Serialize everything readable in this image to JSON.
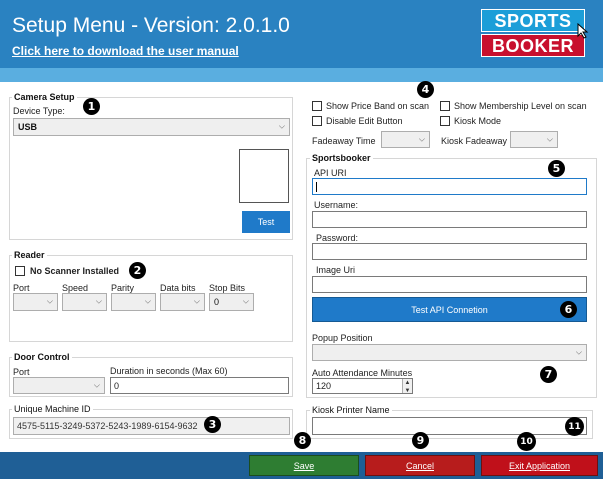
{
  "header": {
    "title": "Setup Menu - Version: 2.0.1.0",
    "manual_link": "Click here to download the user manual",
    "logo_top": "SPORTS",
    "logo_bottom": "BOOKER"
  },
  "camera": {
    "legend": "Camera Setup",
    "device_type_label": "Device Type:",
    "device_type_value": "USB",
    "test_button": "Test"
  },
  "reader": {
    "legend": "Reader",
    "no_scanner_label": "No Scanner Installed",
    "port_label": "Port",
    "speed_label": "Speed",
    "parity_label": "Parity",
    "data_bits_label": "Data bits",
    "stop_bits_label": "Stop Bits",
    "stop_bits_value": "0"
  },
  "door": {
    "legend": "Door Control",
    "port_label": "Port",
    "duration_label": "Duration in seconds (Max 60)",
    "duration_value": "0"
  },
  "machine": {
    "legend": "Unique Machine ID",
    "id_value": "4575-5115-3249-5372-5243-1989-6154-9632"
  },
  "options": {
    "show_price_band": "Show Price Band on scan",
    "show_membership": "Show Membership Level on scan",
    "disable_edit": "Disable Edit Button",
    "kiosk_mode": "Kiosk Mode",
    "fadeaway_time_label": "Fadeaway Time",
    "kiosk_fadeaway_label": "Kiosk Fadeaway"
  },
  "sportsbooker": {
    "legend": "Sportsbooker",
    "api_uri_label": "API URI",
    "username_label": "Username:",
    "password_label": "Password:",
    "image_uri_label": "Image Uri",
    "test_api_button": "Test API Connetion",
    "popup_position_label": "Popup Position",
    "auto_attendance_label": "Auto Attendance Minutes",
    "auto_attendance_value": "120"
  },
  "printer": {
    "legend": "Kiosk Printer Name"
  },
  "footer": {
    "save": "Save",
    "cancel": "Cancel",
    "exit": "Exit Application"
  },
  "badges": [
    "1",
    "2",
    "3",
    "4",
    "5",
    "6",
    "7",
    "8",
    "9",
    "10",
    "11"
  ],
  "colors": {
    "header_blue": "#2a82c1",
    "strip_blue": "#5aaee0",
    "footer_blue": "#1f5f96",
    "test_button": "#1f7ac9",
    "save_green": "#2e7d32",
    "cancel_red": "#b71c1c",
    "exit_red": "#c0101a"
  }
}
